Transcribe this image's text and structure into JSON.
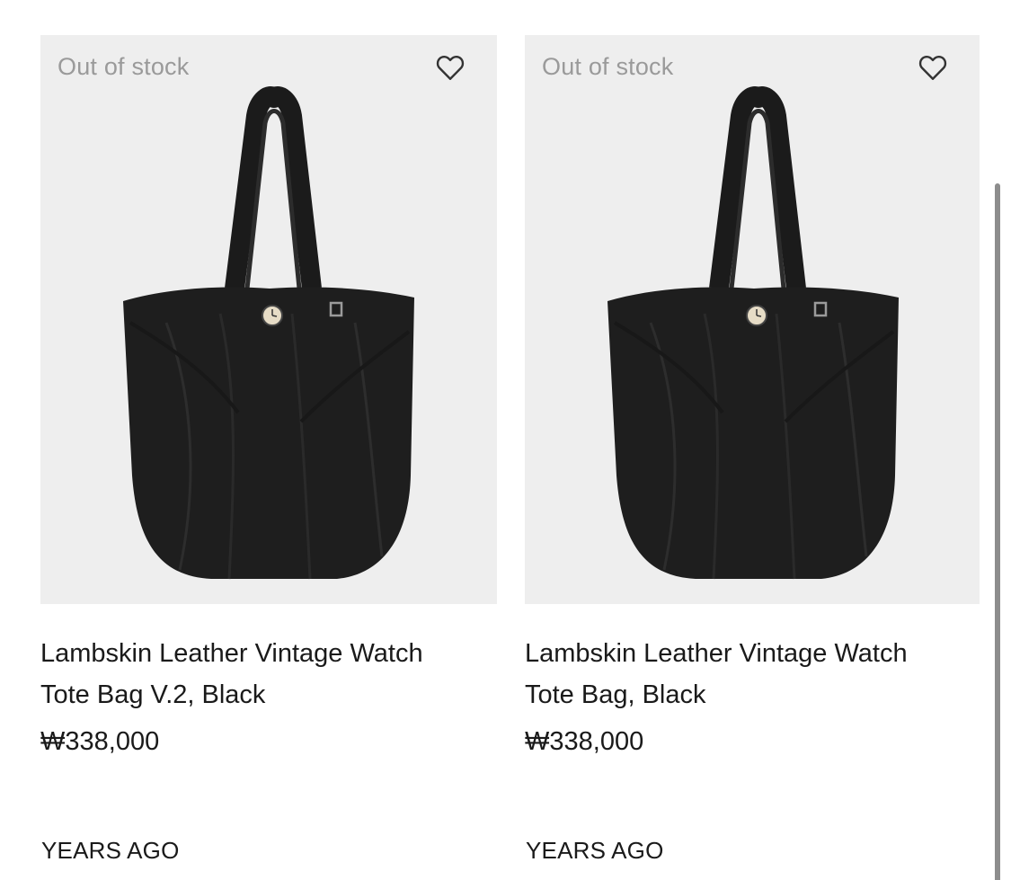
{
  "products": [
    {
      "stock_status": "Out of stock",
      "title_line1": "Lambskin Leather Vintage Watch",
      "title_line2": "Tote Bag V.2, Black",
      "price": "₩338,000",
      "listed": "YEARS AGO",
      "image_icon": "black-leather-tote-bag-image",
      "wishlist_icon": "heart-icon"
    },
    {
      "stock_status": "Out of stock",
      "title_line1": "Lambskin Leather Vintage Watch",
      "title_line2": "Tote Bag, Black",
      "price": "₩338,000",
      "listed": "YEARS AGO",
      "image_icon": "black-leather-tote-bag-image",
      "wishlist_icon": "heart-icon"
    }
  ],
  "colors": {
    "thumbnail_bg": "#eeeeee",
    "stock_text": "#9a9a9a",
    "bag": "#1e1e1e",
    "scrollbar": "#8d8d8d"
  }
}
